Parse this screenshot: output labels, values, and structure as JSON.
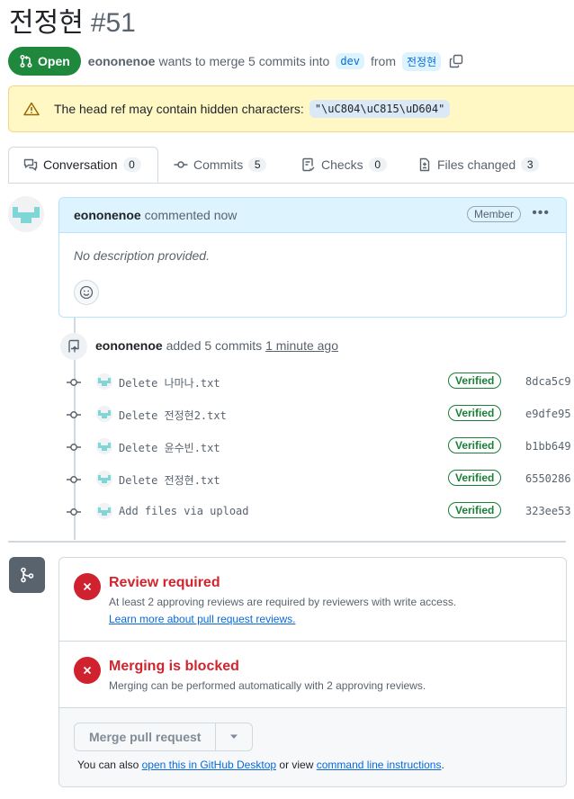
{
  "pr": {
    "title": "전정현",
    "number": "#51",
    "state": "Open",
    "author": "eononenoe",
    "merge_text_1": "wants to merge 5 commits into",
    "base_branch": "dev",
    "merge_text_2": "from",
    "head_branch": "전정현"
  },
  "warning": {
    "text": "The head ref may contain hidden characters:",
    "code": "\"\\uC804\\uC815\\uD604\""
  },
  "tabs": [
    {
      "label": "Conversation",
      "count": "0"
    },
    {
      "label": "Commits",
      "count": "5"
    },
    {
      "label": "Checks",
      "count": "0"
    },
    {
      "label": "Files changed",
      "count": "3"
    }
  ],
  "comment": {
    "author": "eononenoe",
    "action": "commented now",
    "badge": "Member",
    "body": "No description provided."
  },
  "push_event": {
    "author": "eononenoe",
    "action": "added 5 commits",
    "time": "1 minute ago"
  },
  "commits": [
    {
      "message": "Delete 나마나.txt",
      "status": "Verified",
      "sha": "8dca5c9"
    },
    {
      "message": "Delete 전정현2.txt",
      "status": "Verified",
      "sha": "e9dfe95"
    },
    {
      "message": "Delete 윤수빈.txt",
      "status": "Verified",
      "sha": "b1bb649"
    },
    {
      "message": "Delete 전정현.txt",
      "status": "Verified",
      "sha": "6550286"
    },
    {
      "message": "Add files via upload",
      "status": "Verified",
      "sha": "323ee53"
    }
  ],
  "merge_box": {
    "review_title": "Review required",
    "review_text": "At least 2 approving reviews are required by reviewers with write access.",
    "review_link": "Learn more about pull request reviews.",
    "blocked_title": "Merging is blocked",
    "blocked_text": "Merging can be performed automatically with 2 approving reviews.",
    "merge_button": "Merge pull request",
    "also_prefix": "You can also",
    "desktop_link": "open this in GitHub Desktop",
    "also_middle": "or view",
    "cli_link": "command line instructions",
    "also_suffix": "."
  },
  "colors": {
    "open_green": "#1f883d",
    "warning_bg": "#fff8c5",
    "comment_header": "#ddf4ff",
    "error_red": "#cf222e",
    "link_blue": "#0969da"
  }
}
